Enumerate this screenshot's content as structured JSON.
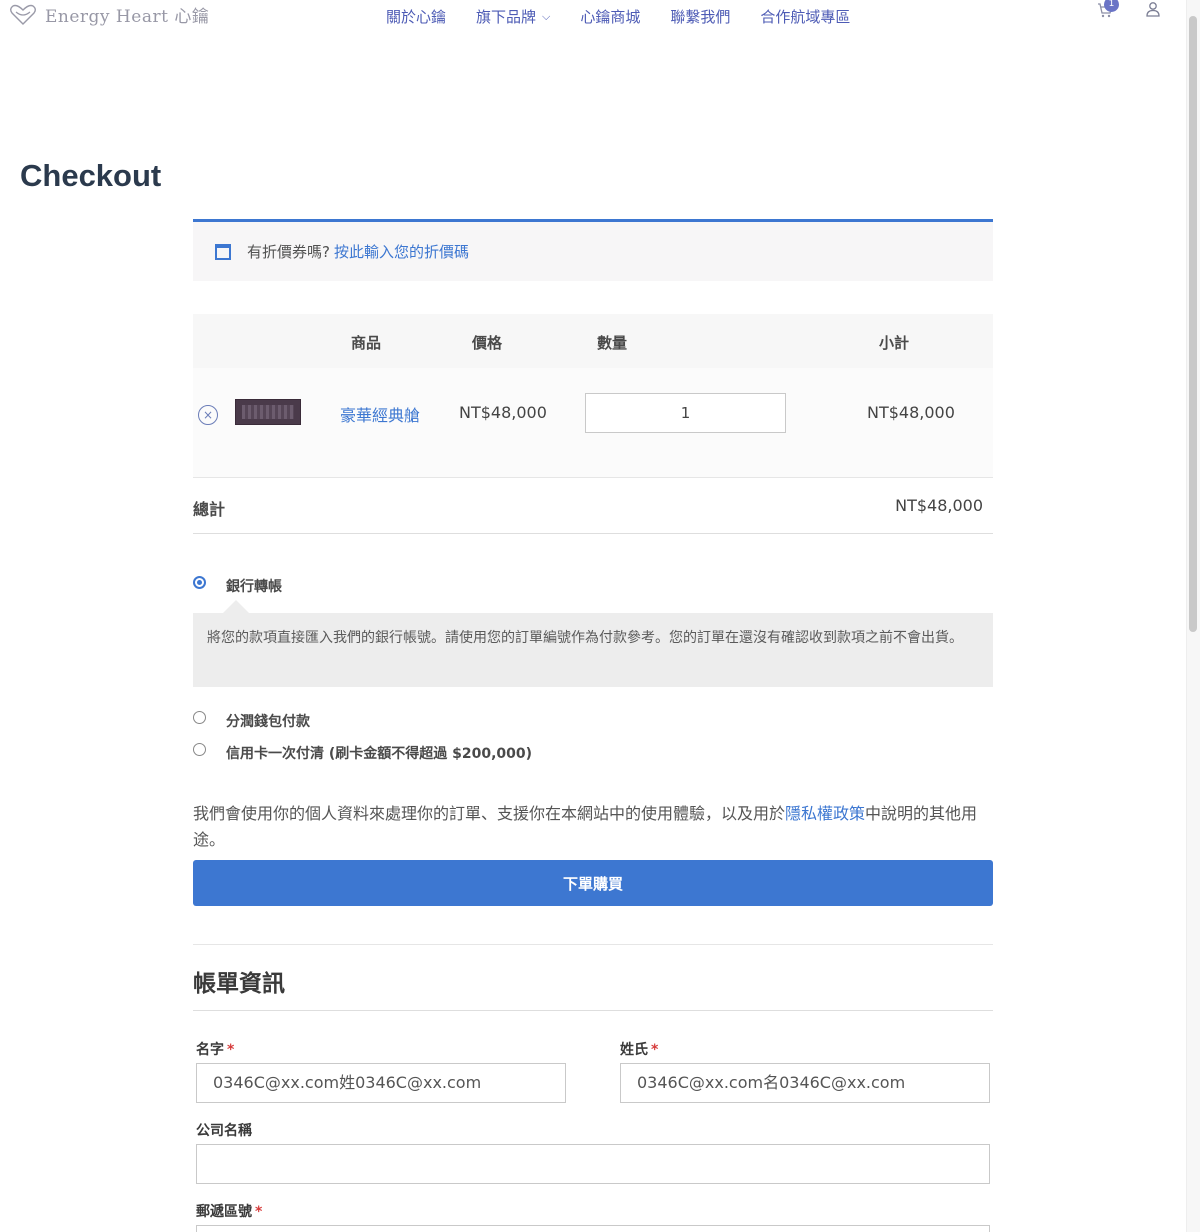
{
  "header": {
    "logo_text": "Energy Heart 心鑰",
    "nav": [
      "關於心鑰",
      "旗下品牌",
      "心鑰商城",
      "聯繫我們",
      "合作航域專區"
    ],
    "cart_count": "1"
  },
  "page": {
    "title": "Checkout"
  },
  "coupon": {
    "prompt": "有折價券嗎?",
    "link": "按此輸入您的折價碼"
  },
  "cart": {
    "headers": {
      "product": "商品",
      "price": "價格",
      "quantity": "數量",
      "subtotal": "小計"
    },
    "item": {
      "remove": "×",
      "name": "豪華經典艙",
      "price": "NT$48,000",
      "quantity": "1",
      "subtotal": "NT$48,000"
    },
    "total_label": "總計",
    "total_value": "NT$48,000"
  },
  "payment": {
    "methods": [
      {
        "label": "銀行轉帳",
        "selected": true
      },
      {
        "label": "分潤錢包付款",
        "selected": false
      },
      {
        "label": "信用卡一次付清 (刷卡金額不得超過 $200,000)",
        "selected": false
      }
    ],
    "bank_description": "將您的款項直接匯入我們的銀行帳號。請使用您的訂單編號作為付款參考。您的訂單在還沒有確認收到款項之前不會出貨。",
    "privacy_before": "我們會使用你的個人資料來處理你的訂單、支援你在本網站中的使用體驗，以及用於",
    "privacy_link": "隱私權政策",
    "privacy_after": "中說明的其他用途。",
    "place_order": "下單購買"
  },
  "billing": {
    "title": "帳單資訊",
    "first_name_label": "名字",
    "first_name_value": "0346C@xx.com姓0346C@xx.com",
    "last_name_label": "姓氏",
    "last_name_value": "0346C@xx.com名0346C@xx.com",
    "company_label": "公司名稱",
    "company_value": "",
    "postcode_label": "郵遞區號",
    "required_mark": "*"
  },
  "colors": {
    "accent": "#3d77d1",
    "nav": "#4d5bb5",
    "required": "#d63b3b"
  }
}
